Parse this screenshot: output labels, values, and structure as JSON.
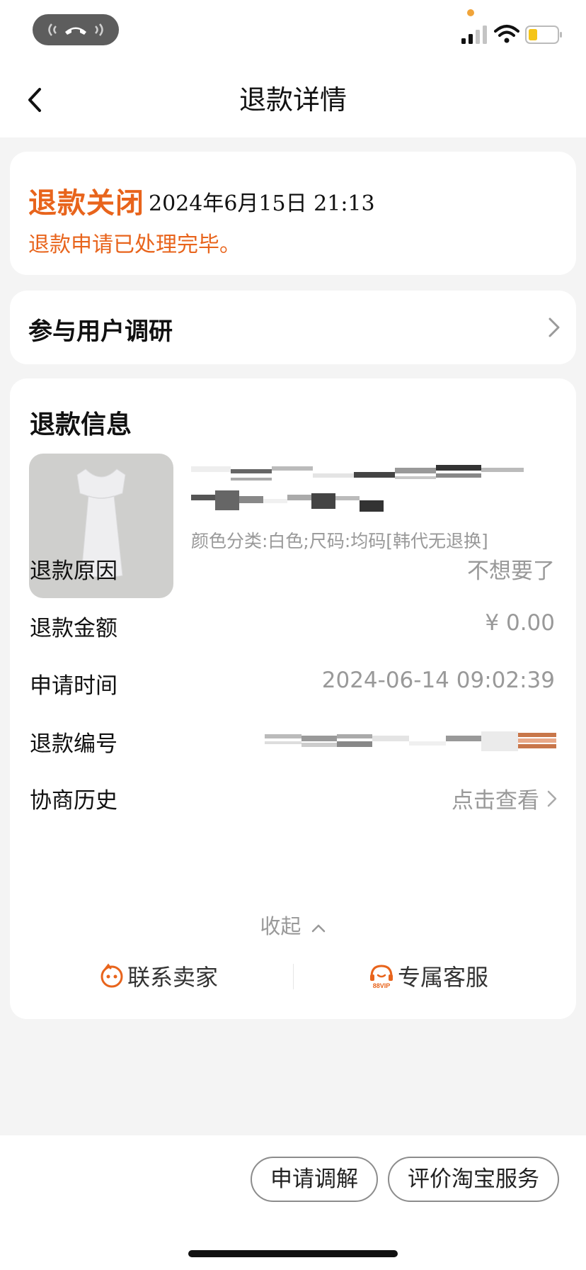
{
  "header": {
    "title": "退款详情"
  },
  "status": {
    "title": "退款关闭",
    "time": "2024年6月15日 21:13",
    "description": "退款申请已处理完毕。"
  },
  "survey": {
    "label": "参与用户调研"
  },
  "info": {
    "title": "退款信息",
    "product_sku": "颜色分类:白色;尺码:均码[韩代无退换]",
    "rows": [
      {
        "label": "退款原因",
        "value": "不想要了"
      },
      {
        "label": "退款金额",
        "value": "¥ 0.00"
      },
      {
        "label": "申请时间",
        "value": "2024-06-14 09:02:39"
      },
      {
        "label": "退款编号",
        "value": ""
      },
      {
        "label": "协商历史",
        "value": "点击查看"
      }
    ],
    "collapse_label": "收起",
    "actions": {
      "contact_seller": "联系卖家",
      "exclusive_service": "专属客服"
    }
  },
  "bottom": {
    "mediate": "申请调解",
    "rate_service": "评价淘宝服务"
  },
  "colors": {
    "accent": "#e8641c",
    "muted": "#999999",
    "background": "#f4f4f4"
  },
  "icons": {
    "call": "phone-call-icon",
    "signal": "signal-icon",
    "wifi": "wifi-icon",
    "battery": "battery-icon",
    "back": "back-arrow-icon",
    "seller": "seller-face-icon",
    "service": "88vip-headset-icon"
  }
}
